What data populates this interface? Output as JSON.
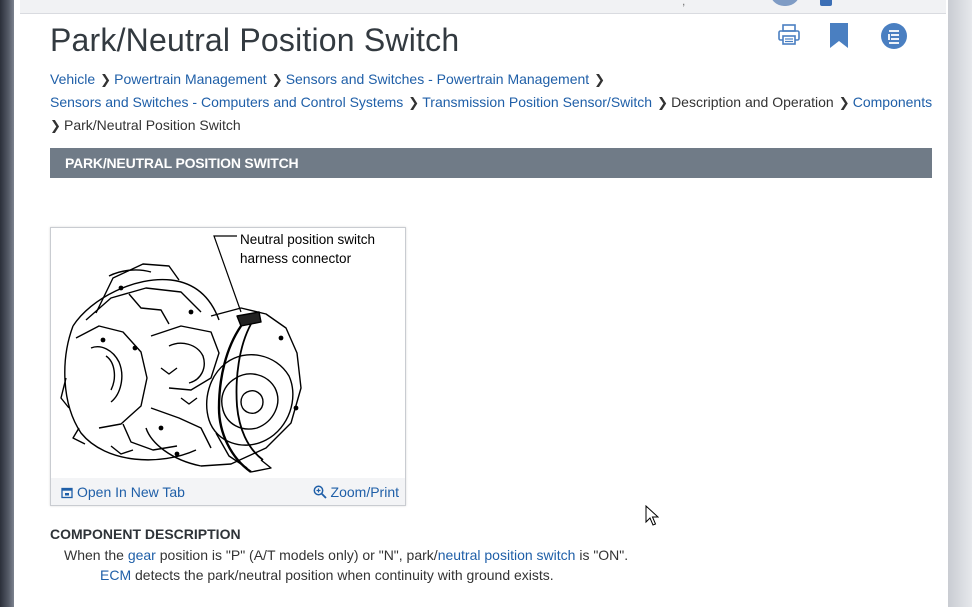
{
  "page": {
    "title": "Park/Neutral Position Switch"
  },
  "breadcrumb": {
    "items": [
      {
        "label": "Vehicle",
        "link": true
      },
      {
        "label": "Powertrain Management",
        "link": true
      },
      {
        "label": "Sensors and Switches - Powertrain Management",
        "link": true
      },
      {
        "label": "Sensors and Switches - Computers and Control Systems",
        "link": true
      },
      {
        "label": "Transmission Position Sensor/Switch",
        "link": true
      },
      {
        "label": "Description and Operation",
        "link": false
      },
      {
        "label": "Components",
        "link": true
      },
      {
        "label": "Park/Neutral Position Switch",
        "link": false
      }
    ]
  },
  "section": {
    "heading": "PARK/NEUTRAL POSITION SWITCH"
  },
  "figure": {
    "callout_line1": "Neutral position switch",
    "callout_line2": "harness connector",
    "open_new_tab": "Open In New Tab",
    "zoom_print": "Zoom/Print"
  },
  "description": {
    "heading": "COMPONENT DESCRIPTION",
    "p1_a": "When the ",
    "p1_link1": "gear",
    "p1_b": " position is \"P\" (A/T models only) or \"N\", park/",
    "p1_link2": "neutral position switch",
    "p1_c": " is \"ON\".",
    "p2_link": "ECM",
    "p2_b": " detects the park/neutral position when continuity with ground exists."
  },
  "colors": {
    "link": "#1f5fa8",
    "section_bar": "#707b87",
    "icon_blue": "#4a7fc1"
  },
  "icons": [
    "print-icon",
    "bookmark-icon",
    "toc-icon",
    "open-tab-icon",
    "zoom-icon"
  ]
}
